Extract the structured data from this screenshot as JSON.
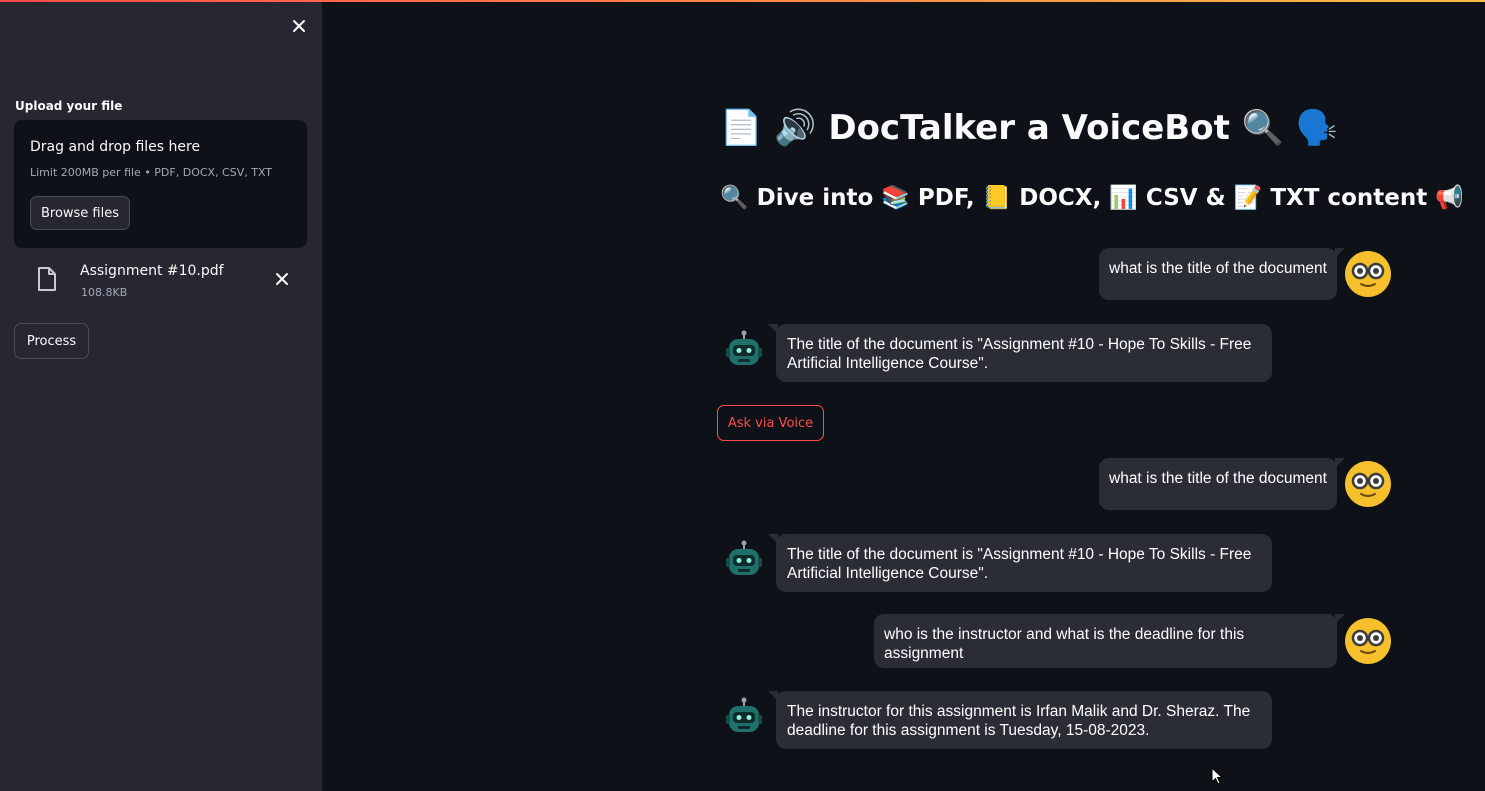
{
  "sidebar": {
    "close_label": "✕",
    "upload_label": "Upload your file",
    "dropzone": {
      "title": "Drag and drop files here",
      "limit": "Limit 200MB per file • PDF, DOCX, CSV, TXT",
      "browse_label": "Browse files"
    },
    "file": {
      "name": "Assignment #10.pdf",
      "size": "108.8KB",
      "remove_label": "✕"
    },
    "process_label": "Process"
  },
  "main": {
    "title": "📄 🔊 DocTalker a VoiceBot 🔍 🗣️",
    "subtitle": "🔍 Dive into 📚 PDF, 📒 DOCX, 📊 CSV & 📝 TXT content 📢",
    "voice_button": "Ask via Voice",
    "messages": [
      {
        "role": "user",
        "text": "what is the title of the document"
      },
      {
        "role": "bot",
        "text": "The title of the document is \"Assignment #10 - Hope To Skills - Free Artificial Intelligence Course\"."
      },
      {
        "role": "user",
        "text": "what is the title of the document"
      },
      {
        "role": "bot",
        "text": "The title of the document is \"Assignment #10 - Hope To Skills - Free Artificial Intelligence Course\"."
      },
      {
        "role": "user",
        "text": "who is the instructor and what is the deadline for this assignment"
      },
      {
        "role": "bot",
        "text": "The instructor for this assignment is Irfan Malik and Dr. Sheraz. The deadline for this assignment is Tuesday, 15-08-2023."
      }
    ]
  },
  "colors": {
    "background": "#0e1117",
    "sidebar": "#262730",
    "bubble": "#2b2d36",
    "accent": "#ff4b4b",
    "user_avatar": "#f5c02c",
    "bot_avatar": "#1f6f6a"
  },
  "icons": {
    "close": "close-icon",
    "file": "file-icon",
    "user_avatar": "nerd-face-icon",
    "bot_avatar": "robot-icon"
  }
}
